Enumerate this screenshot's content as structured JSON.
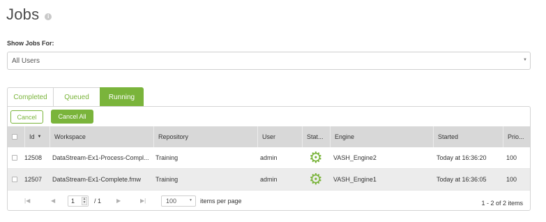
{
  "page": {
    "title": "Jobs",
    "info_glyph": "i"
  },
  "filter": {
    "label": "Show Jobs For:",
    "value": "All Users",
    "caret": "▼"
  },
  "tabs": [
    {
      "label": "Completed"
    },
    {
      "label": "Queued"
    },
    {
      "label": "Running",
      "active": true
    }
  ],
  "actions": {
    "cancel_label": "Cancel",
    "cancel_all_label": "Cancel All"
  },
  "columns": [
    "Id",
    "Workspace",
    "Repository",
    "User",
    "Stat...",
    "Engine",
    "Started",
    "Prio..."
  ],
  "sort_caret": "▼",
  "rows": [
    {
      "id": "12508",
      "workspace": "DataStream-Ex1-Process-Compl...",
      "repository": "Training",
      "user": "admin",
      "status_icon": "gear-icon",
      "engine": "VASH_Engine2",
      "started": "Today at 16:36:20",
      "priority": "100"
    },
    {
      "id": "12507",
      "workspace": "DataStream-Ex1-Complete.fmw",
      "repository": "Training",
      "user": "admin",
      "status_icon": "gear-icon",
      "engine": "VASH_Engine1",
      "started": "Today at 16:36:05",
      "priority": "100"
    }
  ],
  "pager": {
    "first": "|◀",
    "prev": "◀",
    "next": "▶",
    "last": "▶|",
    "page": "1",
    "total": "/ 1",
    "page_size": "100",
    "page_size_caret": "▼",
    "page_size_label": "items per page",
    "range": "1 - 2 of 2 items"
  },
  "colors": {
    "accent": "#7ab43b",
    "header_bg": "#d8d8d8"
  }
}
